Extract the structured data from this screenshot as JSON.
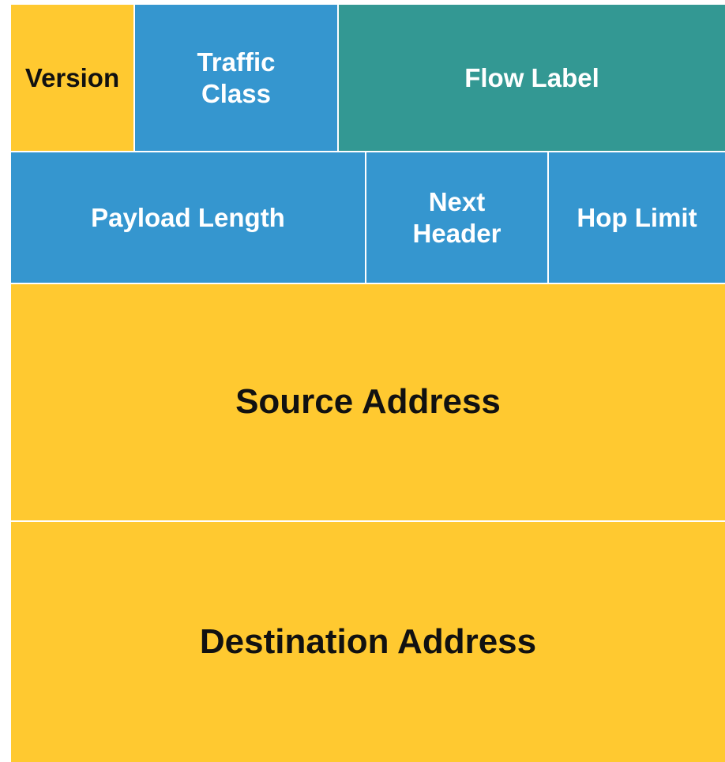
{
  "header_fields": {
    "version": "Version",
    "traffic_class": [
      "Traffic",
      "Class"
    ],
    "flow_label": "Flow Label",
    "payload_length": "Payload Length",
    "next_header": [
      "Next",
      "Header"
    ],
    "hop_limit": "Hop Limit",
    "source_address": "Source Address",
    "destination_address": "Destination Address"
  },
  "colors": {
    "yellow": "#FFC930",
    "blue": "#3596CF",
    "teal": "#339893",
    "text_light": "#FFFFFF",
    "text_dark": "#111111"
  }
}
